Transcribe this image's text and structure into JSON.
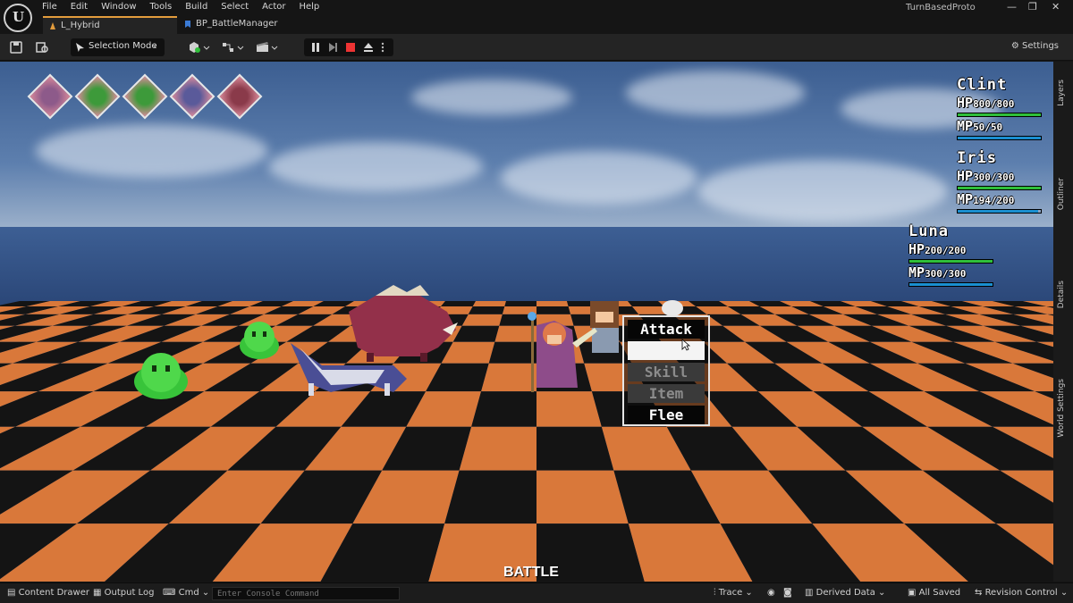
{
  "app": {
    "logo_letter": "U",
    "project_name": "TurnBasedProto"
  },
  "menu": [
    "File",
    "Edit",
    "Window",
    "Tools",
    "Build",
    "Select",
    "Actor",
    "Help"
  ],
  "window_controls": {
    "minimize": "—",
    "restore": "❐",
    "close": "✕"
  },
  "tabs": [
    {
      "label": "L_Hybrid",
      "active": true
    },
    {
      "label": "BP_BattleManager",
      "active": false
    }
  ],
  "toolbar": {
    "selection_mode": "Selection Mode",
    "settings_label": "Settings"
  },
  "turn_order": [
    {
      "name": "mage-portrait",
      "color": "#8d5a8a"
    },
    {
      "name": "slime-portrait",
      "color": "#3d9a3a"
    },
    {
      "name": "slime-portrait",
      "color": "#3d9a3a"
    },
    {
      "name": "wolf-portrait",
      "color": "#5a5a9a"
    },
    {
      "name": "boar-portrait",
      "color": "#8a3a4a"
    }
  ],
  "party": [
    {
      "name": "Clint",
      "hp": "800/800",
      "mp": "50/50",
      "hp_fill": 1.0,
      "mp_fill": 1.0
    },
    {
      "name": "Iris",
      "hp": "300/300",
      "mp": "194/200",
      "hp_fill": 1.0,
      "mp_fill": 0.97
    },
    {
      "name": "Luna",
      "hp": "200/200",
      "mp": "300/300",
      "hp_fill": 1.0,
      "mp_fill": 1.0
    }
  ],
  "stat_labels": {
    "hp": "HP",
    "mp": "MP"
  },
  "command_menu": [
    {
      "label": "Attack",
      "state": "normal"
    },
    {
      "label": "",
      "state": "hover"
    },
    {
      "label": "Skill",
      "state": "disabled"
    },
    {
      "label": "Item",
      "state": "disabled"
    },
    {
      "label": "Flee",
      "state": "normal"
    }
  ],
  "battle_label": "BATTLE",
  "side_tabs": [
    "Layers",
    "Outliner",
    "Details",
    "World Settings"
  ],
  "statusbar": {
    "content_drawer": "Content Drawer",
    "output_log": "Output Log",
    "cmd": "Cmd",
    "console_placeholder": "Enter Console Command",
    "trace": "Trace",
    "derived_data": "Derived Data",
    "all_saved": "All Saved",
    "revision_control": "Revision Control"
  },
  "colors": {
    "hp_bar": "#2fbf3a",
    "mp_bar": "#1a8fd0",
    "tab_accent": "#e39c3c",
    "floor_orange": "#d9783a",
    "floor_dark": "#141414"
  }
}
